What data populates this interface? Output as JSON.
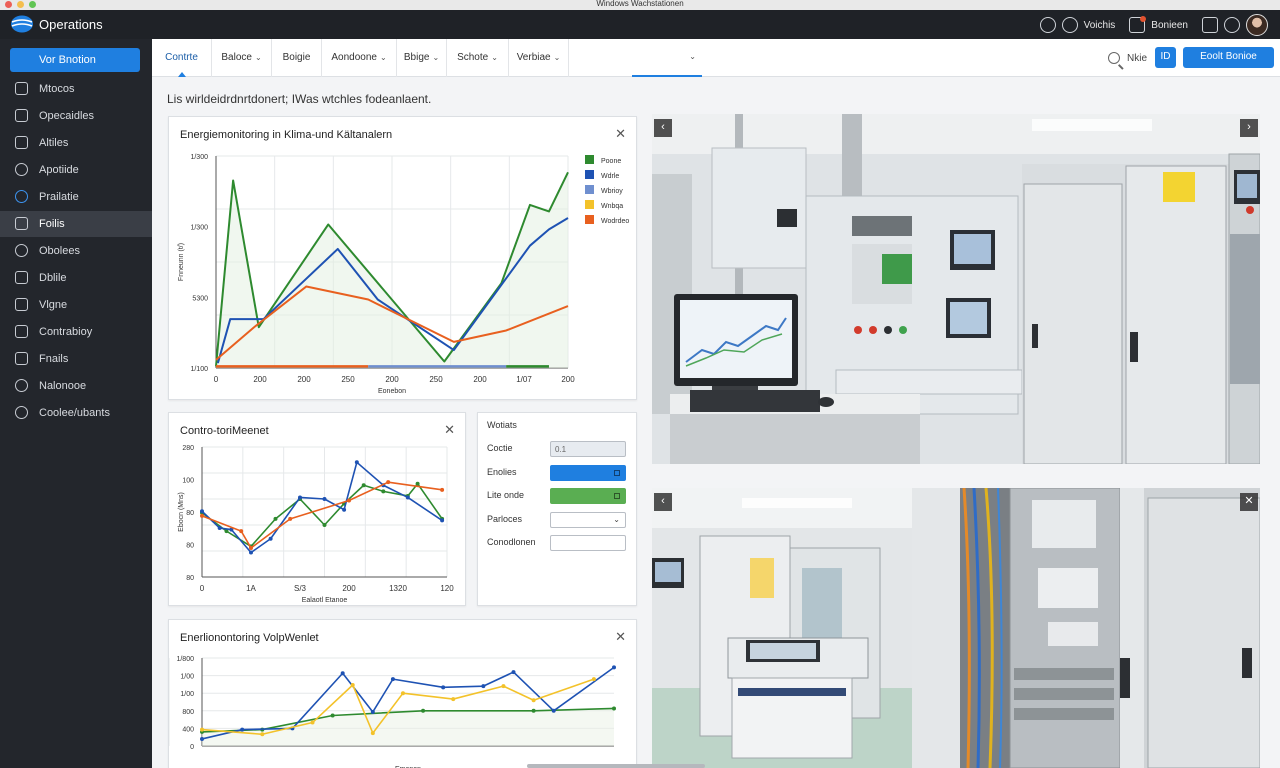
{
  "window": {
    "title": "Windows Wachstationen"
  },
  "app": {
    "name": "Operations"
  },
  "topbar": {
    "user_label": "Voichis",
    "notif_label": "Bonieen"
  },
  "sidebar": {
    "primary": "Vor Bnotion",
    "items": [
      {
        "label": "Mtocos",
        "icon": "monitor-icon"
      },
      {
        "label": "Opecaidles",
        "icon": "pen-icon"
      },
      {
        "label": "Altiles",
        "icon": "list-icon"
      },
      {
        "label": "Apotiide",
        "icon": "gauge-icon"
      },
      {
        "label": "Prailatie",
        "icon": "info-icon"
      },
      {
        "label": "Foilis",
        "icon": "home-icon"
      },
      {
        "label": "Obolees",
        "icon": "gauge-icon"
      },
      {
        "label": "Dblile",
        "icon": "pen-icon"
      },
      {
        "label": "Vlgne",
        "icon": "list-icon"
      },
      {
        "label": "Contrabioy",
        "icon": "settings-icon"
      },
      {
        "label": "Fnails",
        "icon": "home-icon"
      },
      {
        "label": "Nalonooe",
        "icon": "globe-icon"
      },
      {
        "label": "Coolee/ubants",
        "icon": "gear-icon"
      }
    ],
    "active_index": 5
  },
  "tabs": [
    {
      "label": "Contrte",
      "dropdown": false
    },
    {
      "label": "Baloce",
      "dropdown": true
    },
    {
      "label": "Boigie",
      "dropdown": false
    },
    {
      "label": "Aondoone",
      "dropdown": true
    },
    {
      "label": "Bbige",
      "dropdown": true
    },
    {
      "label": "Schote",
      "dropdown": true
    },
    {
      "label": "Verbiae",
      "dropdown": true
    }
  ],
  "toolbar": {
    "search_label": "Nkie",
    "square_label": "ID",
    "action_label": "Eoolt Bonioe"
  },
  "subheading": "Lis wirldeidrdnrtdonert; IWas wtchles fodeanlaent.",
  "chart_data": [
    {
      "type": "line",
      "title": "Energiemonitoring in Klima-und Kältanalern",
      "xlabel": "Eonebon",
      "ylabel": "Fnneunn (t/)",
      "x_ticks": [
        "0",
        "200",
        "200",
        "250",
        "200",
        "250",
        "200",
        "1/07",
        "200"
      ],
      "y_ticks": [
        "1/300",
        "1/300",
        "5300",
        "1/100"
      ],
      "ylim": [
        0,
        1300
      ],
      "legend": [
        "Poone",
        "Wdrle",
        "Wbrioy",
        "Wnbqa",
        "Wodrdeo"
      ],
      "legend_position": "top-right",
      "legend_colors": [
        "#2e8a2f",
        "#1e52b3",
        "#6f8fcf",
        "#f3c22a",
        "#e8601f"
      ],
      "series": [
        {
          "color": "#2e8a2f",
          "values": [
            [
              0,
              10
            ],
            [
              18,
              1150
            ],
            [
              45,
              250
            ],
            [
              118,
              880
            ],
            [
              240,
              40
            ],
            [
              300,
              520
            ],
            [
              330,
              1000
            ],
            [
              350,
              960
            ],
            [
              370,
              1200
            ]
          ]
        },
        {
          "color": "#1e52b3",
          "values": [
            [
              2,
              30
            ],
            [
              15,
              300
            ],
            [
              50,
              300
            ],
            [
              128,
              730
            ],
            [
              170,
              420
            ],
            [
              250,
              110
            ],
            [
              330,
              750
            ],
            [
              350,
              850
            ],
            [
              370,
              920
            ]
          ]
        },
        {
          "color": "#e8601f",
          "values": [
            [
              0,
              50
            ],
            [
              40,
              250
            ],
            [
              95,
              500
            ],
            [
              160,
              420
            ],
            [
              250,
              160
            ],
            [
              305,
              230
            ],
            [
              370,
              380
            ]
          ]
        }
      ]
    },
    {
      "type": "line",
      "title": "Contro-toriMeenet",
      "xlabel": "Ealaotl Etanoe",
      "ylabel": "Ebocn (Mns)",
      "x_ticks": [
        "0",
        "1A",
        "S/3",
        "200",
        "1320",
        "120"
      ],
      "y_ticks": [
        "280",
        "100",
        "80",
        "80",
        "80"
      ],
      "series": [
        {
          "color": "#2e8a2f",
          "values": [
            [
              0,
              42
            ],
            [
              25,
              30
            ],
            [
              50,
              20
            ],
            [
              75,
              38
            ],
            [
              100,
              51
            ],
            [
              125,
              34
            ],
            [
              145,
              48
            ],
            [
              165,
              60
            ],
            [
              185,
              56
            ],
            [
              210,
              53
            ],
            [
              220,
              61
            ],
            [
              245,
              38
            ]
          ]
        },
        {
          "color": "#1e52b3",
          "values": [
            [
              0,
              43
            ],
            [
              18,
              32
            ],
            [
              30,
              31
            ],
            [
              50,
              16
            ],
            [
              70,
              25
            ],
            [
              100,
              52
            ],
            [
              125,
              51
            ],
            [
              145,
              44
            ],
            [
              158,
              75
            ],
            [
              185,
              60
            ],
            [
              210,
              52
            ],
            [
              245,
              37
            ]
          ]
        },
        {
          "color": "#e8601f",
          "values": [
            [
              0,
              40
            ],
            [
              40,
              30
            ],
            [
              50,
              19
            ],
            [
              90,
              38
            ],
            [
              150,
              50
            ],
            [
              190,
              62
            ],
            [
              245,
              57
            ]
          ]
        }
      ]
    },
    {
      "type": "line",
      "title": "Enerlionontoring VolpWenlet",
      "xlabel": "Emenen",
      "y_ticks": [
        "1/800",
        "1/00",
        "1/00",
        "800",
        "400",
        "0"
      ],
      "series": [
        {
          "color": "#2e8a2f",
          "values": [
            [
              0,
              12
            ],
            [
              60,
              14
            ],
            [
              130,
              26
            ],
            [
              220,
              30
            ],
            [
              330,
              30
            ],
            [
              410,
              32
            ]
          ]
        },
        {
          "color": "#1e52b3",
          "values": [
            [
              0,
              6
            ],
            [
              40,
              14
            ],
            [
              90,
              15
            ],
            [
              140,
              62
            ],
            [
              170,
              29
            ],
            [
              190,
              57
            ],
            [
              240,
              50
            ],
            [
              280,
              51
            ],
            [
              310,
              63
            ],
            [
              350,
              30
            ],
            [
              410,
              67
            ]
          ]
        },
        {
          "color": "#f3c22a",
          "values": [
            [
              0,
              14
            ],
            [
              60,
              10
            ],
            [
              110,
              20
            ],
            [
              150,
              52
            ],
            [
              170,
              11
            ],
            [
              200,
              45
            ],
            [
              250,
              40
            ],
            [
              300,
              51
            ],
            [
              330,
              39
            ],
            [
              390,
              57
            ]
          ]
        }
      ]
    }
  ],
  "settings_panel": {
    "title": "Wotiats",
    "rows": [
      {
        "label": "Coctie",
        "value": "0.1",
        "style": "grey"
      },
      {
        "label": "Enolies",
        "value": "",
        "style": "blue"
      },
      {
        "label": "Lite onde",
        "value": "",
        "style": "green"
      },
      {
        "label": "Parloces",
        "value": "",
        "style": "dropdown"
      },
      {
        "label": "Conodlonen",
        "value": "",
        "style": "empty"
      }
    ]
  }
}
